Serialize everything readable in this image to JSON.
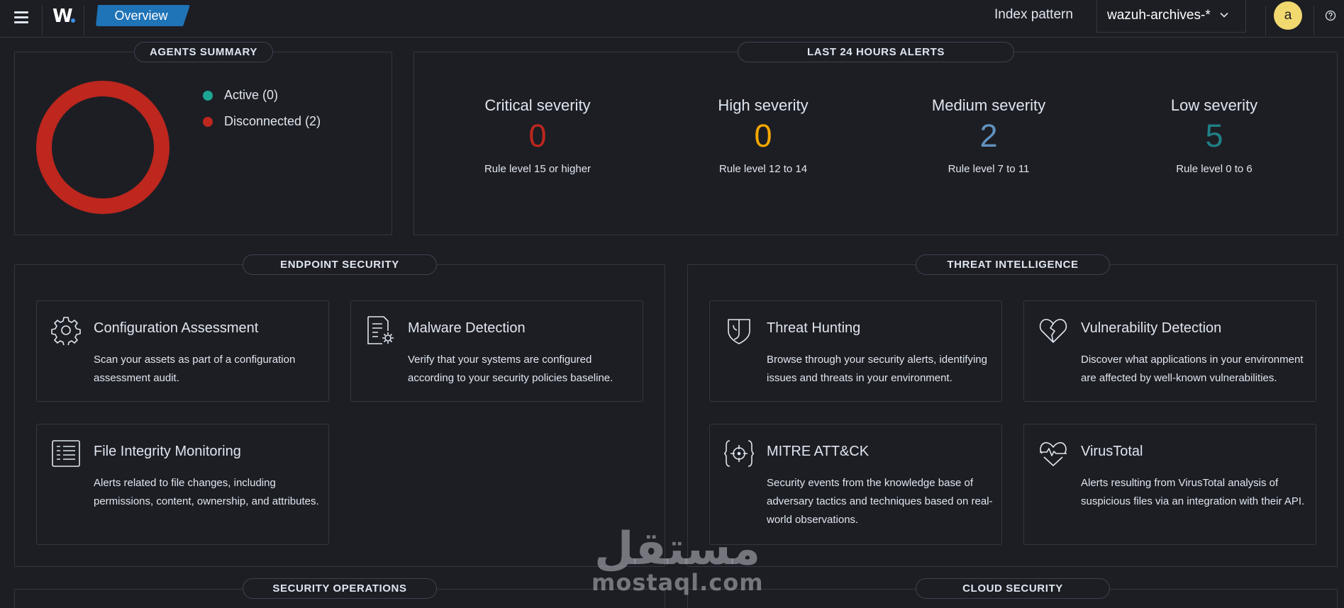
{
  "header": {
    "logo": "W",
    "breadcrumb": "Overview",
    "index_pattern_label": "Index pattern",
    "index_pattern_value": "wazuh-archives-*",
    "avatar_letter": "a"
  },
  "agents_summary": {
    "title": "AGENTS SUMMARY",
    "legend": [
      {
        "label": "Active (0)",
        "color": "#1ea593"
      },
      {
        "label": "Disconnected (2)",
        "color": "#bd271e"
      }
    ]
  },
  "alerts": {
    "title": "LAST 24 HOURS ALERTS",
    "items": [
      {
        "title": "Critical severity",
        "value": "0",
        "sub": "Rule level 15 or higher",
        "color": "#bd271e"
      },
      {
        "title": "High severity",
        "value": "0",
        "sub": "Rule level 12 to 14",
        "color": "#f5a700"
      },
      {
        "title": "Medium severity",
        "value": "2",
        "sub": "Rule level 7 to 11",
        "color": "#6092c0"
      },
      {
        "title": "Low severity",
        "value": "5",
        "sub": "Rule level 0 to 6",
        "color": "#1e8085"
      }
    ]
  },
  "endpoint_security": {
    "title": "ENDPOINT SECURITY",
    "cards": [
      {
        "title": "Configuration Assessment",
        "desc": "Scan your assets as part of a configuration assessment audit.",
        "icon": "gear-icon"
      },
      {
        "title": "Malware Detection",
        "desc": "Verify that your systems are configured according to your security policies baseline.",
        "icon": "document-gear-icon"
      },
      {
        "title": "File Integrity Monitoring",
        "desc": "Alerts related to file changes, including permissions, content, ownership, and attributes.",
        "icon": "list-document-icon"
      }
    ]
  },
  "threat_intelligence": {
    "title": "THREAT INTELLIGENCE",
    "cards": [
      {
        "title": "Threat Hunting",
        "desc": "Browse through your security alerts, identifying issues and threats in your environment.",
        "icon": "shield-icon"
      },
      {
        "title": "Vulnerability Detection",
        "desc": "Discover what applications in your environment are affected by well-known vulnerabilities.",
        "icon": "broken-heart-icon"
      },
      {
        "title": "MITRE ATT&CK",
        "desc": "Security events from the knowledge base of adversary tactics and techniques based on real-world observations.",
        "icon": "target-icon"
      },
      {
        "title": "VirusTotal",
        "desc": "Alerts resulting from VirusTotal analysis of suspicious files via an integration with their API.",
        "icon": "heartbeat-icon"
      }
    ]
  },
  "security_operations": {
    "title": "SECURITY OPERATIONS"
  },
  "cloud_security": {
    "title": "CLOUD SECURITY"
  },
  "watermark": {
    "arabic": "مستقل",
    "latin": "mostaql.com"
  }
}
